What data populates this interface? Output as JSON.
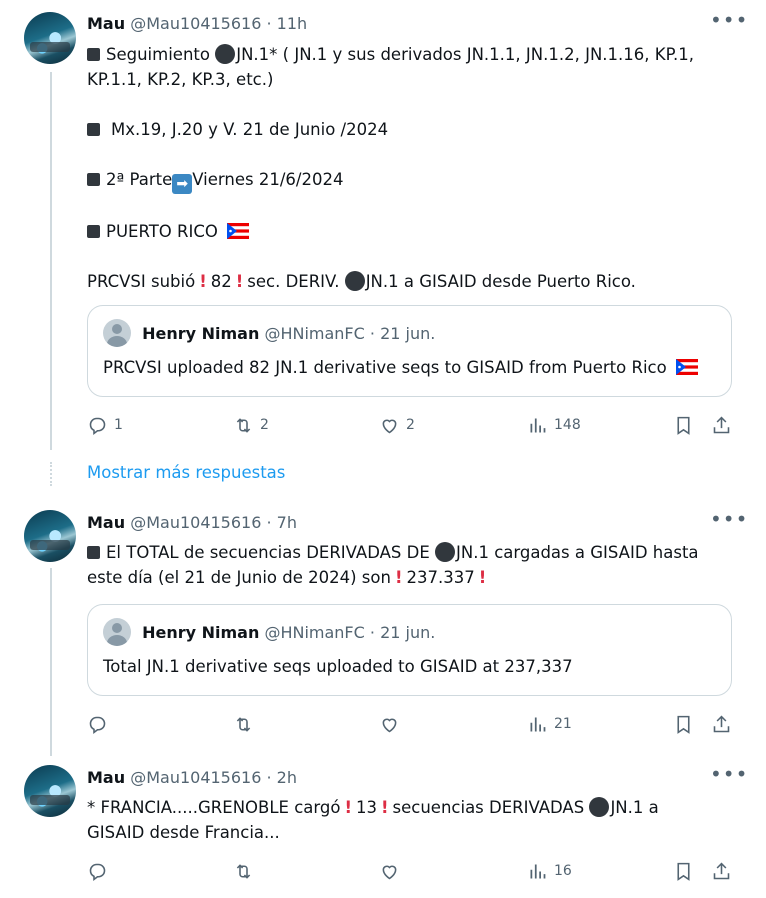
{
  "posts": [
    {
      "name": "Mau",
      "handle": "@Mau10415616 · 11h",
      "l1a": "Seguimiento ",
      "l1b": "JN.1* ( JN.1 y sus derivados JN.1.1, JN.1.2, JN.1.16, KP.1,",
      "l1c": "KP.1.1, KP.2, KP.3, etc.)",
      "l2": "Mx.19, J.20 y V. 21 de Junio /2024",
      "l3a": "2ª Parte",
      "l3b": "Viernes 21/6/2024",
      "l4": "PUERTO RICO",
      "l5a": "PRCVSI subió",
      "l5b": "82",
      "l5c": "sec. DERIV. ",
      "l5d": "JN.1 a GISAID desde Puerto Rico.",
      "quote": {
        "name": "Henry Niman",
        "handle": "@HNimanFC · 21 jun.",
        "text": "PRCVSI uploaded 82 JN.1 derivative seqs to GISAID from Puerto Rico"
      },
      "replies": "1",
      "reposts": "2",
      "likes": "2",
      "views": "148"
    },
    {
      "name": "Mau",
      "handle": "@Mau10415616 · 7h",
      "l1a": "El TOTAL de secuencias DERIVADAS DE ",
      "l1b": "JN.1 cargadas a GISAID hasta",
      "l2": "este día (el 21 de Junio de 2024) son",
      "l2b": "237.337",
      "quote": {
        "name": "Henry Niman",
        "handle": "@HNimanFC · 21 jun.",
        "text": "Total JN.1 derivative seqs uploaded to GISAID at 237,337"
      },
      "views": "21"
    },
    {
      "name": "Mau",
      "handle": "@Mau10415616 · 2h",
      "l1a": "* FRANCIA.....GRENOBLE cargó",
      "l1b": "13",
      "l1c": "secuencias DERIVADAS ",
      "l1d": "JN.1 a",
      "l2": "GISAID desde Francia...",
      "views": "16"
    }
  ],
  "show_more": "Mostrar más respuestas",
  "icons": {
    "more": "more-horizontal-icon",
    "reply": "reply-icon",
    "repost": "repost-icon",
    "like": "heart-icon",
    "views": "views-icon",
    "bookmark": "bookmark-icon",
    "share": "share-icon"
  },
  "colors": {
    "link": "#1d9bf0",
    "muted": "#536471",
    "exclamation": "#dd2e44"
  }
}
